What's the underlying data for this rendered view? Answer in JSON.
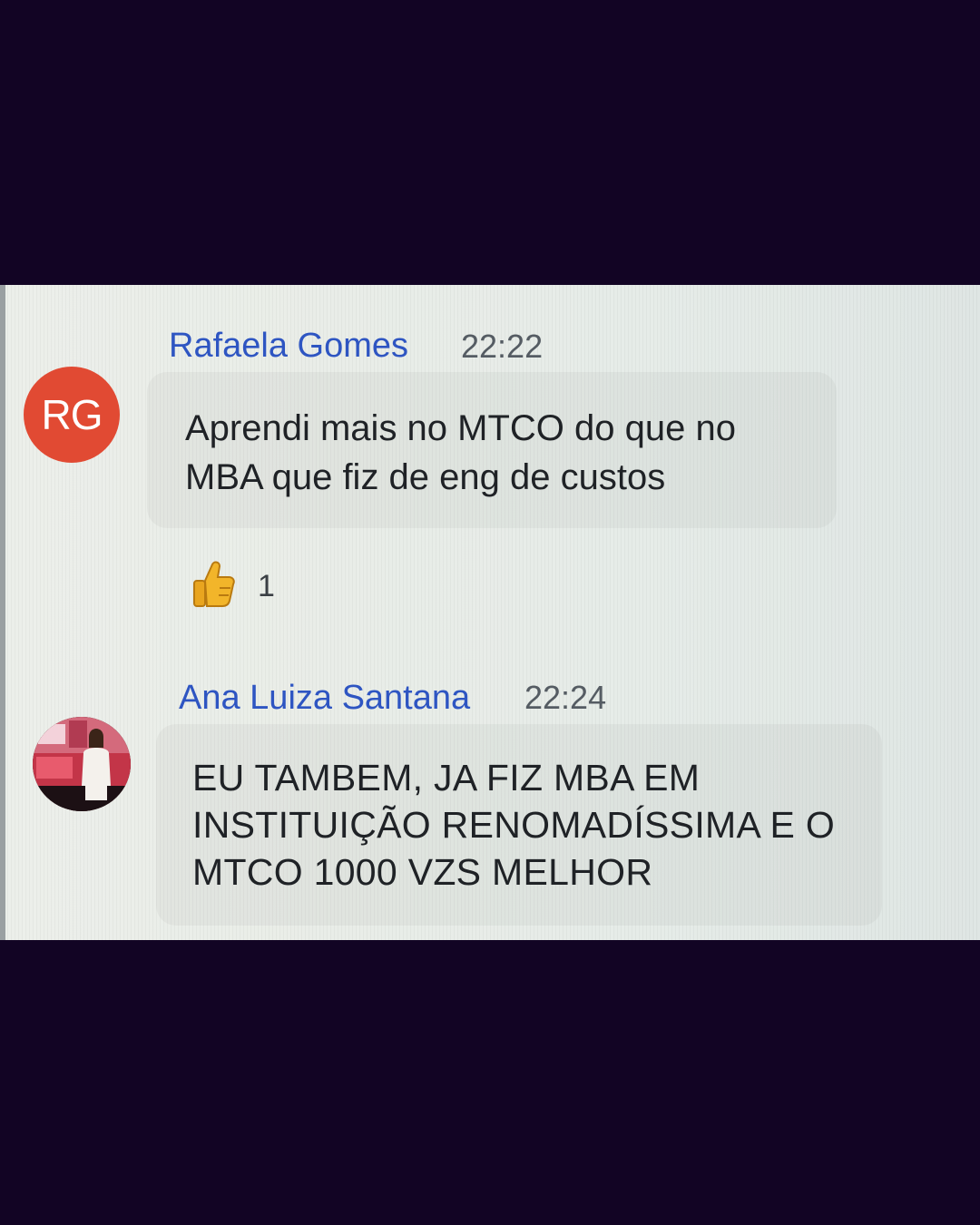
{
  "messages": [
    {
      "sender": "Rafaela Gomes",
      "time": "22:22",
      "avatar_initials": "RG",
      "avatar_color": "#e14a33",
      "body_lines": [
        "Aprendi mais no MTCO do que no",
        "MBA que fiz de eng de custos"
      ],
      "reaction": {
        "icon": "thumbs-up-icon",
        "count": "1"
      }
    },
    {
      "sender": "Ana Luiza Santana",
      "time": "22:24",
      "avatar": "profile-photo",
      "body_lines": [
        "EU TAMBEM, JA FIZ MBA EM",
        "INSTITUIÇÃO RENOMADÍSSIMA E O",
        "MTCO 1000 VZS MELHOR"
      ]
    }
  ],
  "colors": {
    "sender_name": "#2e55c2",
    "timestamp": "#555c63",
    "message_text": "#1f2226",
    "frame_background": "#120424"
  }
}
